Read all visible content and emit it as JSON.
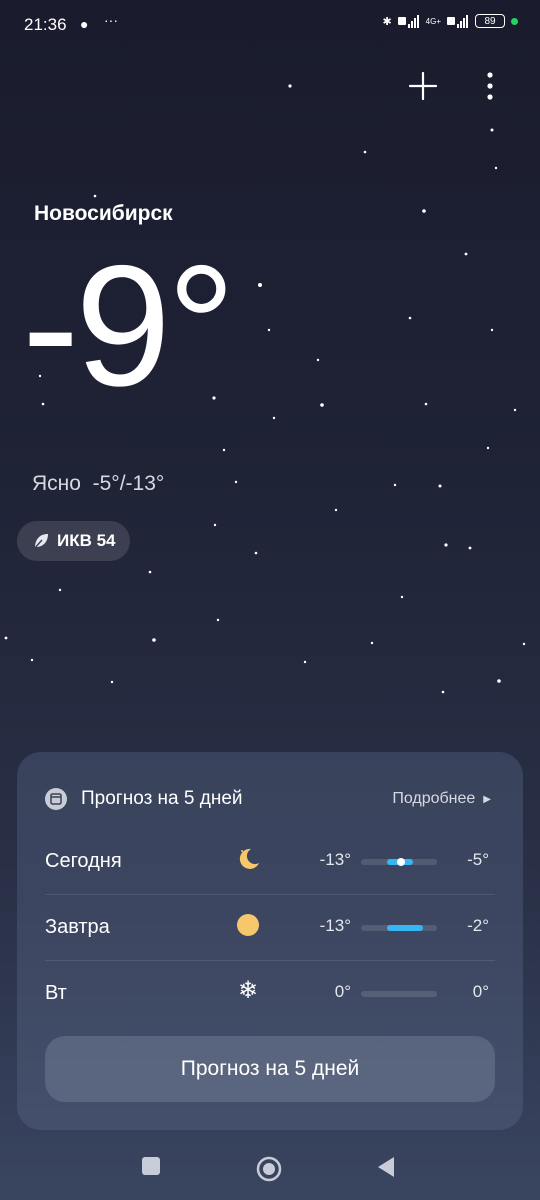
{
  "status": {
    "time": "21:36",
    "battery": "89",
    "net": "4G+"
  },
  "location": {
    "city": "Новосибирск"
  },
  "current": {
    "temperature": "-9°",
    "condition": "Ясно",
    "range": "-5°/-13°"
  },
  "aqi": {
    "label": "ИКВ 54"
  },
  "forecast": {
    "title": "Прогноз на 5 дней",
    "more_label": "Подробнее",
    "button_label": "Прогноз на 5 дней",
    "days": [
      {
        "name": "Сегодня",
        "icon": "moon-icon",
        "min": "-13°",
        "max": "-5°"
      },
      {
        "name": "Завтра",
        "icon": "sun-icon",
        "min": "-13°",
        "max": "-2°"
      },
      {
        "name": "Вт",
        "icon": "snowflake-icon",
        "min": "0°",
        "max": "0°"
      }
    ]
  },
  "colors": {
    "accent": "#36b6f3",
    "moon": "#f6c86b",
    "sun": "#f6c86b"
  }
}
